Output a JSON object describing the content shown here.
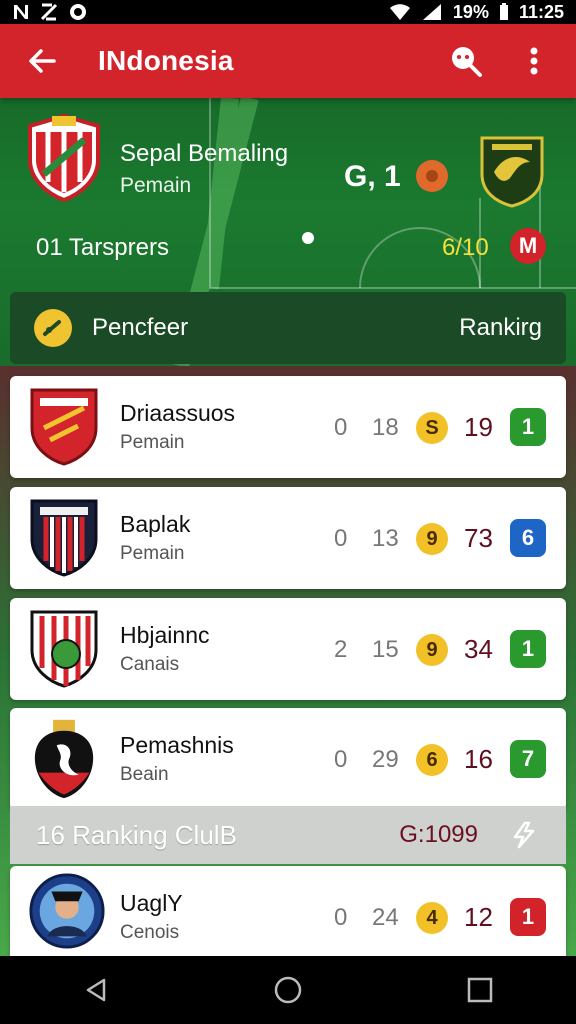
{
  "status_bar": {
    "battery": "19%",
    "time": "11:25"
  },
  "app_bar": {
    "title": "INdonesia",
    "back_icon": "arrow-left-icon",
    "search_icon": "search-icon",
    "menu_icon": "more-vert-icon"
  },
  "match": {
    "home": {
      "name": "Sepal Bemaling",
      "subtitle": "Pemain"
    },
    "score": "G, 1",
    "transfers_label": "01 Tarsprers",
    "transfers_value": "6/10",
    "badge_letter": "M"
  },
  "section": {
    "title": "Pencfeer",
    "right_label": "Rankirg"
  },
  "clubs": [
    {
      "name": "Driaassuos",
      "subtitle": "Pemain",
      "col1": "0",
      "col2": "18",
      "badge": "S",
      "points": "19",
      "rank": "1",
      "rank_color": "#2a9a2f"
    },
    {
      "name": "Baplak",
      "subtitle": "Pemain",
      "col1": "0",
      "col2": "13",
      "badge": "9",
      "points": "73",
      "rank": "6",
      "rank_color": "#1d66c6"
    },
    {
      "name": "Hbjainnc",
      "subtitle": "Canais",
      "col1": "2",
      "col2": "15",
      "badge": "9",
      "points": "34",
      "rank": "1",
      "rank_color": "#2a9a2f"
    },
    {
      "name": "Pemashnis",
      "subtitle": "Beain",
      "col1": "0",
      "col2": "29",
      "badge": "6",
      "points": "16",
      "rank": "7",
      "rank_color": "#2a9a2f"
    },
    {
      "name": "UaglY",
      "subtitle": "Cenois",
      "col1": "0",
      "col2": "24",
      "badge": "4",
      "points": "12",
      "rank": "1",
      "rank_color": "#d3232a"
    }
  ],
  "ranking_bar": {
    "label": "16 Ranking ClulB",
    "value": "G:1099"
  },
  "colors": {
    "primary": "#d2242a",
    "pitch": "#1b7a2f",
    "accent": "#f2c128"
  }
}
